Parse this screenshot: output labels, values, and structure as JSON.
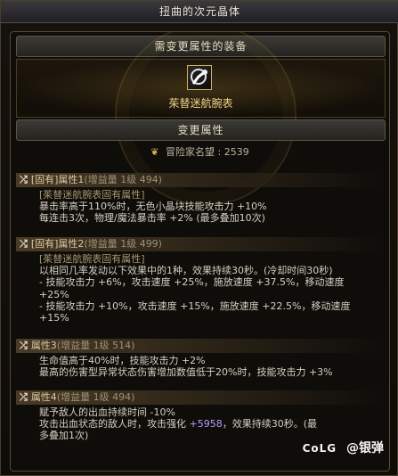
{
  "window": {
    "title": "扭曲的次元晶体"
  },
  "equip_section": {
    "header": "需变更属性的装备",
    "item_name": "茱替迷航腕表",
    "item_icon": "watch-icon"
  },
  "change_section": {
    "header": "变更属性",
    "fame_label": "冒险家名望 : 2539"
  },
  "attributes": [
    {
      "title": "[固有]属性1",
      "tier": "(增益量 1级 494)",
      "lines": [
        {
          "text": "[茱替迷航腕表固有属性]",
          "style": "sub"
        },
        {
          "text": "暴击率高于110%时，无色小晶块技能攻击力 +10%",
          "style": "main"
        },
        {
          "text": "每连击3次，物理/魔法暴击率 +2% (最多叠加10次)",
          "style": "main"
        }
      ]
    },
    {
      "title": "[固有]属性2",
      "tier": "(增益量 1级 499)",
      "lines": [
        {
          "text": "[茱替迷航腕表固有属性]",
          "style": "sub"
        },
        {
          "text": "以相同几率发动以下效果中的1种，效果持续30秒。(冷却时间30秒)",
          "style": "main"
        },
        {
          "text": "- 技能攻击力 +6%，攻击速度 +25%，施放速度 +37.5%，移动速度",
          "style": "main"
        },
        {
          "text": "+25%",
          "style": "main"
        },
        {
          "text": "- 技能攻击力 +10%，攻击速度 +15%，施放速度 +22.5%，移动速度",
          "style": "main"
        },
        {
          "text": "+15%",
          "style": "main"
        }
      ]
    },
    {
      "title": "属性3",
      "tier": "(增益量 1级 514)",
      "lines": [
        {
          "text": "生命值高于40%时，技能攻击力 +2%",
          "style": "main"
        },
        {
          "text": "最高的伤害型异常状态伤害增加数值低于20%时，技能攻击力 +3%",
          "style": "main"
        }
      ]
    },
    {
      "title": "属性4",
      "tier": "(增益量 1级 494)",
      "lines": [
        {
          "text": "赋予敌人的出血持续时间 -10%",
          "style": "main"
        },
        {
          "text": "攻击出血状态的敌人时，攻击强化 ",
          "style": "main",
          "highlight": "+5958",
          "after": "，效果持续30秒。(最"
        },
        {
          "text": "多叠加1次)",
          "style": "main"
        }
      ]
    }
  ],
  "watermark": {
    "brand": "CoLG",
    "author": "@银弹"
  },
  "icons": {
    "shuffle": "shuffle-icon",
    "fame": "fame-crest-icon"
  },
  "colors": {
    "item_name": "#f1d58a",
    "highlight": "#b79cff",
    "header_text": "#e6dcc0"
  }
}
